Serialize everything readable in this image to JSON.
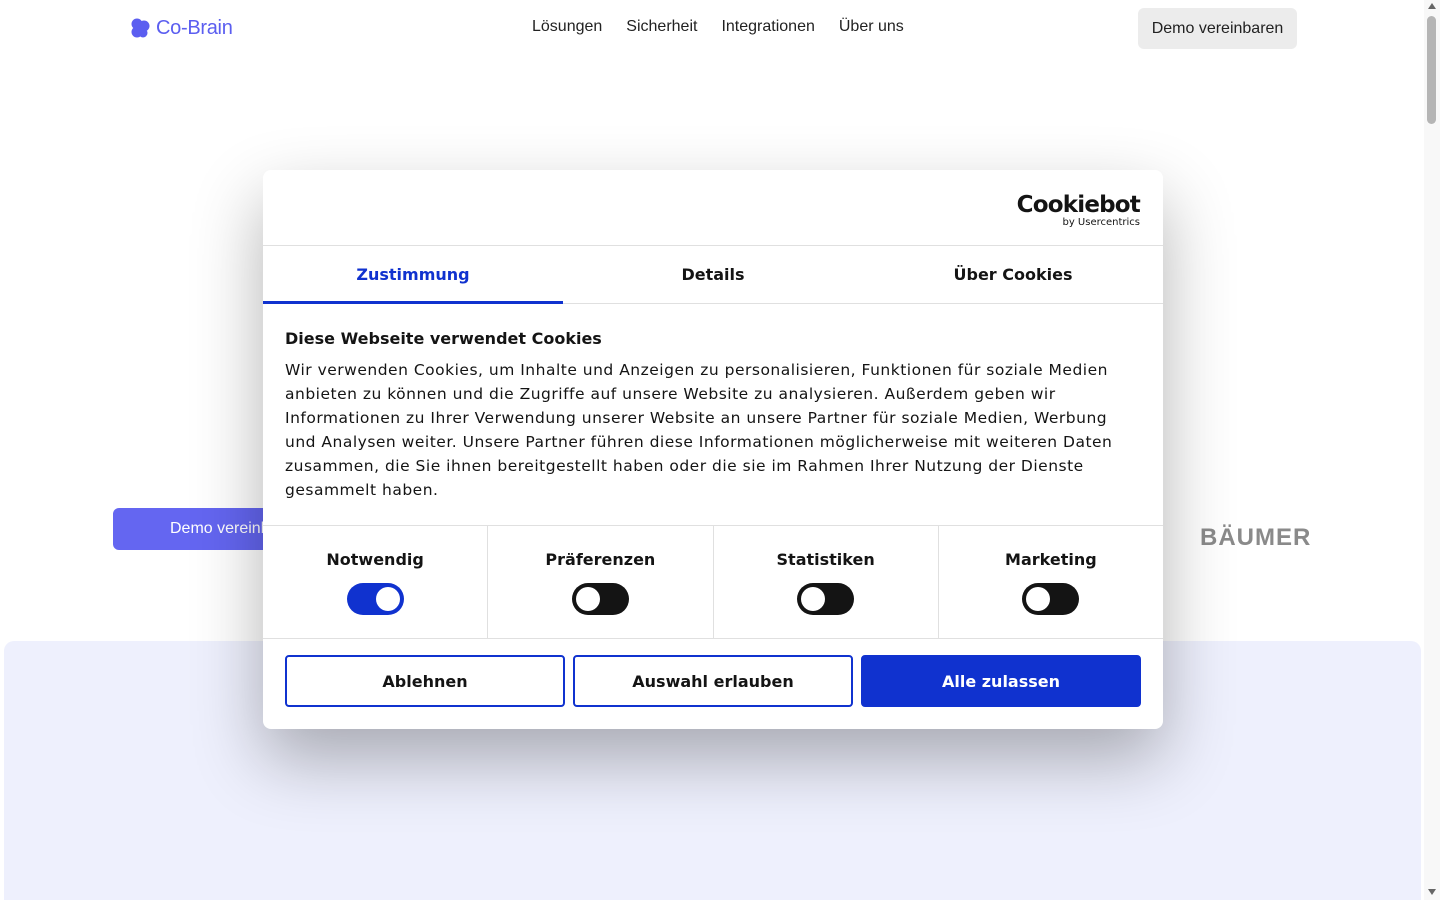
{
  "header": {
    "logo_text": "Co-Brain",
    "nav": [
      "Lösungen",
      "Sicherheit",
      "Integrationen",
      "Über uns"
    ],
    "demo_button": "Demo vereinbaren",
    "brand_color": "#5b5ef0"
  },
  "hero": {
    "demo_button": "Demo vereinb",
    "logo_strip_text": "BÄUMER"
  },
  "cookie_dialog": {
    "brand": "Cookiebot",
    "brand_sub": "by Usercentrics",
    "tabs": [
      {
        "label": "Zustimmung",
        "active": true
      },
      {
        "label": "Details",
        "active": false
      },
      {
        "label": "Über Cookies",
        "active": false
      }
    ],
    "title": "Diese Webseite verwendet Cookies",
    "text": "Wir verwenden Cookies, um Inhalte und Anzeigen zu personalisieren, Funktionen für soziale Medien anbieten zu können und die Zugriffe auf unsere Website zu analysieren. Außerdem geben wir Informationen zu Ihrer Verwendung unserer Website an unsere Partner für soziale Medien, Werbung und Analysen weiter. Unsere Partner führen diese Informationen möglicherweise mit weiteren Daten zusammen, die Sie ihnen bereitgestellt haben oder die sie im Rahmen Ihrer Nutzung der Dienste gesammelt haben.",
    "categories": [
      {
        "label": "Notwendig",
        "enabled": true
      },
      {
        "label": "Präferenzen",
        "enabled": false
      },
      {
        "label": "Statistiken",
        "enabled": false
      },
      {
        "label": "Marketing",
        "enabled": false
      }
    ],
    "buttons": {
      "decline": "Ablehnen",
      "allow_selection": "Auswahl erlauben",
      "allow_all": "Alle zulassen"
    },
    "accent_color": "#1032cf"
  }
}
